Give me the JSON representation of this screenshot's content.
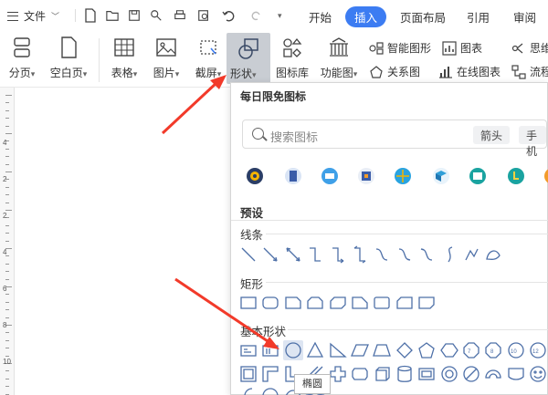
{
  "menubar": {
    "file_label": "文件",
    "tabs": [
      {
        "label": "开始",
        "active": false
      },
      {
        "label": "插入",
        "active": true
      },
      {
        "label": "页面布局",
        "active": false
      },
      {
        "label": "引用",
        "active": false
      },
      {
        "label": "审阅",
        "active": false
      }
    ]
  },
  "ribbon": {
    "page_break": "分页",
    "blank_page": "空白页",
    "table": "表格",
    "picture": "图片",
    "screenshot": "截屏",
    "shape": "形状",
    "icon_lib": "图标库",
    "func_chart": "功能图",
    "smart_graphic": "智能图形",
    "chart": "图表",
    "mind": "思维",
    "relation": "关系图",
    "online_chart": "在线图表",
    "flow": "流程"
  },
  "panel": {
    "title": "每日限免图标",
    "search_placeholder": "搜索图标",
    "chips": [
      "箭头",
      "手机"
    ],
    "sections": {
      "preset": "预设",
      "lines": "线条",
      "rect": "矩形",
      "basic": "基本形状"
    },
    "tooltip": "椭圆"
  },
  "ruler": {
    "numbers": [
      "4",
      "2",
      "2",
      "4",
      "6",
      "8",
      "10",
      "12"
    ]
  },
  "colors": {
    "accent": "#3c7cf2",
    "shape_stroke": "#4e70a8",
    "arrow": "#f23a2a"
  }
}
